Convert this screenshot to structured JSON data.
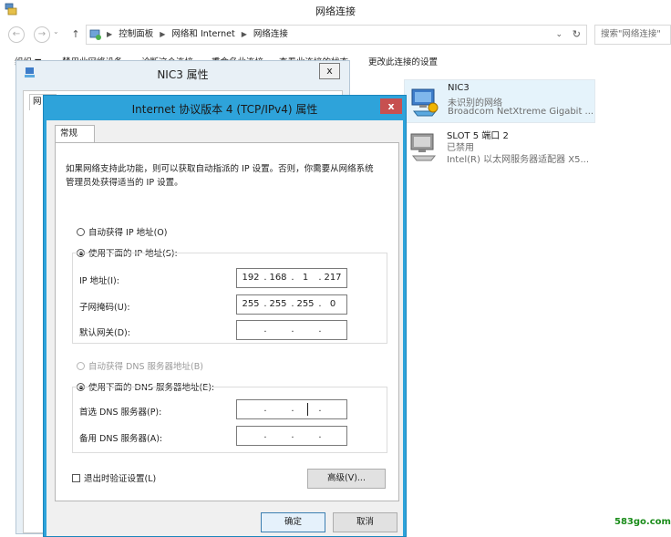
{
  "window": {
    "title": "网络连接"
  },
  "address": {
    "crumbs": [
      "控制面板",
      "网络和 Internet",
      "网络连接"
    ],
    "search_placeholder": "搜索\"网络连接\""
  },
  "nav": {
    "back": "←",
    "forward": "→",
    "up": "↑",
    "dropdown": "⌄",
    "refresh": "↻"
  },
  "commandbar": {
    "items": [
      "组织 ▼",
      "禁用此网络设备",
      "诊断这个连接",
      "重命名此连接",
      "查看此连接的状态",
      "更改此连接的设置"
    ]
  },
  "connections": [
    {
      "name": "NIC3",
      "status": "未识别的网络",
      "device": "Broadcom NetXtreme Gigabit ...",
      "selected": true
    },
    {
      "name": "SLOT 5 端口 2",
      "status": "已禁用",
      "device": "Intel(R) 以太网服务器适配器 X5...",
      "selected": false
    }
  ],
  "nic3_dialog": {
    "title": "NIC3 属性",
    "tab_label": "网",
    "close_label": "x"
  },
  "ipv4_dialog": {
    "title": "Internet 协议版本 4 (TCP/IPv4) 属性",
    "close_label": "x",
    "tab_label": "常规",
    "intro": "如果网络支持此功能，则可以获取自动指派的 IP 设置。否则，你需要从网络系统管理员处获得适当的 IP 设置。",
    "auto_ip_label": "自动获得 IP 地址(O)",
    "manual_ip_label": "使用下面的 IP 地址(S):",
    "ip_label": "IP 地址(I):",
    "ip_value": [
      "192",
      "168",
      "1",
      "217"
    ],
    "subnet_label": "子网掩码(U):",
    "subnet_value": [
      "255",
      "255",
      "255",
      "0"
    ],
    "gateway_label": "默认网关(D):",
    "gateway_value": [
      "",
      "",
      "",
      ""
    ],
    "auto_dns_label": "自动获得 DNS 服务器地址(B)",
    "manual_dns_label": "使用下面的 DNS 服务器地址(E):",
    "preferred_dns_label": "首选 DNS 服务器(P):",
    "preferred_dns_value": [
      "",
      "",
      "",
      ""
    ],
    "alternate_dns_label": "备用 DNS 服务器(A):",
    "alternate_dns_value": [
      "",
      "",
      "",
      ""
    ],
    "validate_label": "退出时验证设置(L)",
    "advanced_label": "高级(V)...",
    "ok_label": "确定",
    "cancel_label": "取消"
  },
  "watermark": "583go.com"
}
